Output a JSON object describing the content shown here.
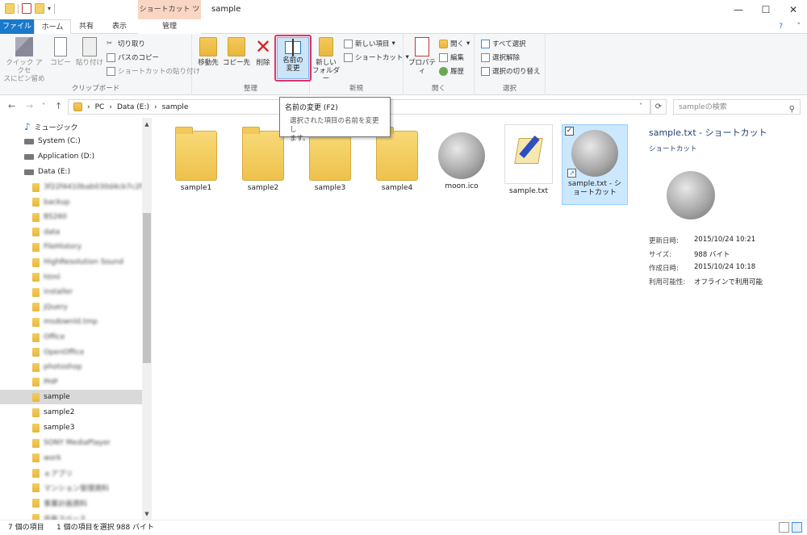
{
  "window": {
    "title": "sample",
    "context_tab": "ショートカット ツール",
    "min_icon": "—",
    "max_icon": "☐",
    "close_icon": "✕"
  },
  "tabs": {
    "file": "ファイル",
    "home": "ホーム",
    "share": "共有",
    "view": "表示",
    "manage": "管理"
  },
  "ribbon": {
    "clipboard": {
      "label": "クリップボード",
      "pin": "クイック アクセ\nスにピン留め",
      "copy": "コピー",
      "paste": "貼り付け",
      "cut": "切り取り",
      "copy_path": "パスのコピー",
      "paste_shortcut": "ショートカットの貼り付け"
    },
    "organize": {
      "label": "整理",
      "move_to": "移動先",
      "copy_to": "コピー先",
      "delete": "削除",
      "rename": "名前の\n変更"
    },
    "new": {
      "label": "新規",
      "new_folder": "新しい\nフォルダー",
      "new_item": "新しい項目",
      "shortcut": "ショートカット"
    },
    "open": {
      "label": "開く",
      "properties": "プロパティ",
      "open": "開く",
      "edit": "編集",
      "history": "履歴"
    },
    "select": {
      "label": "選択",
      "select_all": "すべて選択",
      "select_none": "選択解除",
      "invert": "選択の切り替え"
    }
  },
  "address": {
    "crumb_pc": "PC",
    "crumb_drive": "Data (E:)",
    "crumb_folder": "sample",
    "search_placeholder": "sampleの検索"
  },
  "nav": {
    "music": "ミュージック",
    "system": "System (C:)",
    "application": "Application (D:)",
    "data": "Data (E:)",
    "folders_blurred": [
      "3f22f4410bab030d4cb7c2f36",
      "backup",
      "BS260",
      "data",
      "FileHistory",
      "HighResolution Sound",
      "html",
      "installer",
      "jQuery",
      "msdownld.tmp",
      "Office",
      "OpenOffice",
      "photoshop",
      "PHP"
    ],
    "sample": "sample",
    "sample2": "sample2",
    "sample3": "sample3",
    "folders_blurred_after": [
      "SONY MediaPlayer",
      "work",
      "ｅアプリ",
      "マンション管理資料",
      "事業計画資料",
      "共有スペース"
    ]
  },
  "files": [
    {
      "name": "sample1",
      "type": "folder"
    },
    {
      "name": "sample2",
      "type": "folder"
    },
    {
      "name": "sample3",
      "type": "folder"
    },
    {
      "name": "sample4",
      "type": "folder"
    },
    {
      "name": "moon.ico",
      "type": "moon"
    },
    {
      "name": "sample.txt",
      "type": "txt"
    },
    {
      "name": "sample.txt - ショートカット",
      "type": "shortcut"
    }
  ],
  "tooltip": {
    "title": "名前の変更 (F2)",
    "desc": "選択された項目の名前を変更し\nます。"
  },
  "details": {
    "title": "sample.txt - ショートカット",
    "type": "ショートカット",
    "modified_label": "更新日時:",
    "modified": "2015/10/24 10:21",
    "size_label": "サイズ:",
    "size": "988 バイト",
    "created_label": "作成日時:",
    "created": "2015/10/24 10:18",
    "avail_label": "利用可能性:",
    "avail": "オフラインで利用可能"
  },
  "status": {
    "count": "7 個の項目",
    "selected": "1 個の項目を選択",
    "size": "988 バイト"
  }
}
